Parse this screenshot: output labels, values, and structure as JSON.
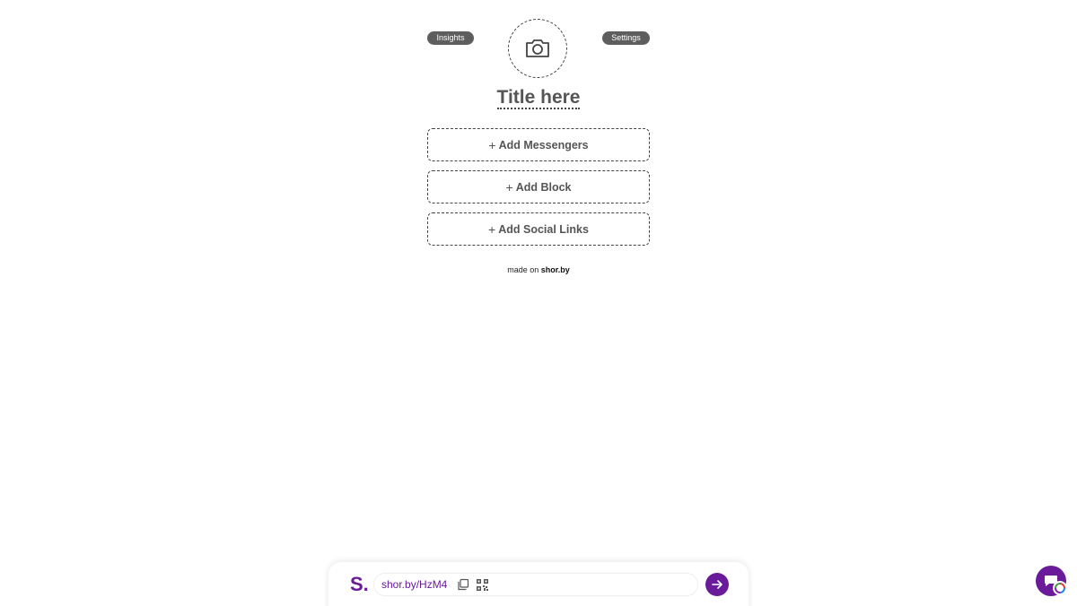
{
  "header": {
    "insights_label": "Insights",
    "settings_label": "Settings"
  },
  "profile": {
    "avatar_icon": "camera-icon",
    "title": "Title here"
  },
  "actions": [
    {
      "label": "Add Messengers",
      "icon": "plus-icon"
    },
    {
      "label": "Add Block",
      "icon": "plus-icon"
    },
    {
      "label": "Add Social Links",
      "icon": "plus-icon"
    }
  ],
  "footer": {
    "made_on": "made on",
    "brand": "shor.by"
  },
  "bottom_bar": {
    "logo": "S.",
    "url": "shor.by/HzM4",
    "copy_icon": "copy-icon",
    "qr_icon": "qr-code-icon",
    "go_icon": "arrow-right-icon"
  },
  "chat": {
    "icon": "chat-icon"
  },
  "colors": {
    "brand": "#6a1b9a",
    "pill_bg": "#5e5e5e",
    "text": "#555555"
  }
}
